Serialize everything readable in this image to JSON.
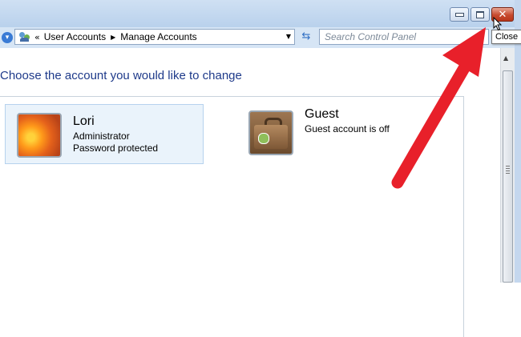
{
  "address_bar": {
    "breadcrumbs": [
      "User Accounts",
      "Manage Accounts"
    ],
    "search_placeholder": "Search Control Panel"
  },
  "main": {
    "heading": "Choose the account you would like to change",
    "accounts": [
      {
        "name": "Lori",
        "lines": [
          "Administrator",
          "Password protected"
        ],
        "icon": "flower-avatar-icon"
      },
      {
        "name": "Guest",
        "lines": [
          "Guest account is off"
        ],
        "icon": "briefcase-avatar-icon"
      }
    ]
  },
  "window_controls": {
    "tooltip": "Close"
  },
  "annotation": {
    "arrow_color": "#e8202a"
  }
}
